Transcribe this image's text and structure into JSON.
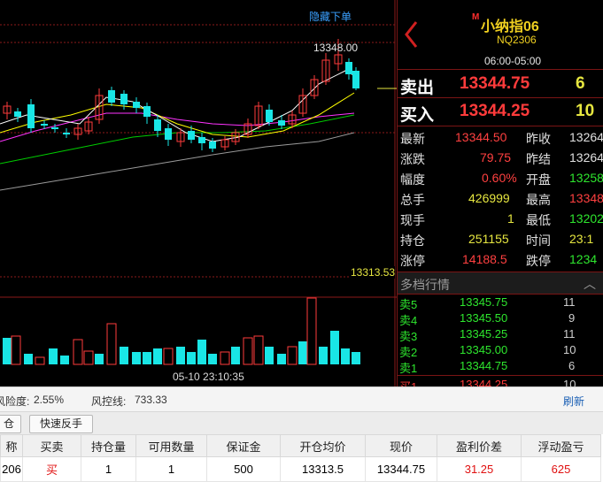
{
  "chart": {
    "hide_order_label": "隐藏下单",
    "high_label": "13348.00",
    "price_marker": "13313.53",
    "time_label": "05-10 23:10:35",
    "last_price_level": 13344.75,
    "colors": {
      "up": "#ff3b3b",
      "down": "#19e6e6",
      "ma1": "#ffffff",
      "ma2": "#ffff00",
      "ma3": "#ff33ff",
      "ma4": "#00cc00",
      "ma5": "#9a9a9a"
    }
  },
  "quote": {
    "title": "小纳指06",
    "title_marker": "M",
    "code": "NQ2306",
    "session": "06:00-05:00",
    "sell": {
      "label": "卖出",
      "price": "13344.75",
      "volume": "6"
    },
    "buy": {
      "label": "买入",
      "price": "13344.25",
      "volume": "10"
    },
    "rows": [
      {
        "l1": "最新",
        "v1": "13344.50",
        "l2": "昨收",
        "v2": "13264"
      },
      {
        "l1": "涨跌",
        "v1": "79.75",
        "l2": "昨结",
        "v2": "13264"
      },
      {
        "l1": "幅度",
        "v1": "0.60%",
        "l2": "开盘",
        "v2": "13258"
      },
      {
        "l1": "总手",
        "v1": "426999",
        "l2": "最高",
        "v2": "13348"
      },
      {
        "l1": "现手",
        "v1": "1",
        "l2": "最低",
        "v2": "13202"
      },
      {
        "l1": "持仓",
        "v1": "251155",
        "l2": "时间",
        "v2": "23:1"
      },
      {
        "l1": "涨停",
        "v1": "14188.5",
        "l2": "跌停",
        "v2": "1234"
      }
    ],
    "depth_title": "多档行情",
    "depth": [
      {
        "side": "卖5",
        "price": "13345.75",
        "qty": "11"
      },
      {
        "side": "卖4",
        "price": "13345.50",
        "qty": "9"
      },
      {
        "side": "卖3",
        "price": "13345.25",
        "qty": "11"
      },
      {
        "side": "卖2",
        "price": "13345.00",
        "qty": "10"
      },
      {
        "side": "卖1",
        "price": "13344.75",
        "qty": "6"
      },
      {
        "side": "买1",
        "price": "13344.25",
        "qty": "10"
      }
    ]
  },
  "status": {
    "risk_label": "风险度:",
    "risk_value": "2.55%",
    "control_label": "风控线:",
    "control_value": "733.33",
    "refresh": "刷新"
  },
  "toolbar": {
    "close_label": "仓",
    "reverse_label": "快速反手"
  },
  "positions": {
    "headers": [
      "称",
      "买卖",
      "持仓量",
      "可用数量",
      "保证金",
      "开仓均价",
      "现价",
      "盈利价差",
      "浮动盈亏"
    ],
    "rows": [
      [
        "206",
        "买",
        "1",
        "1",
        "500",
        "13313.5",
        "13344.75",
        "31.25",
        "625"
      ]
    ]
  }
}
